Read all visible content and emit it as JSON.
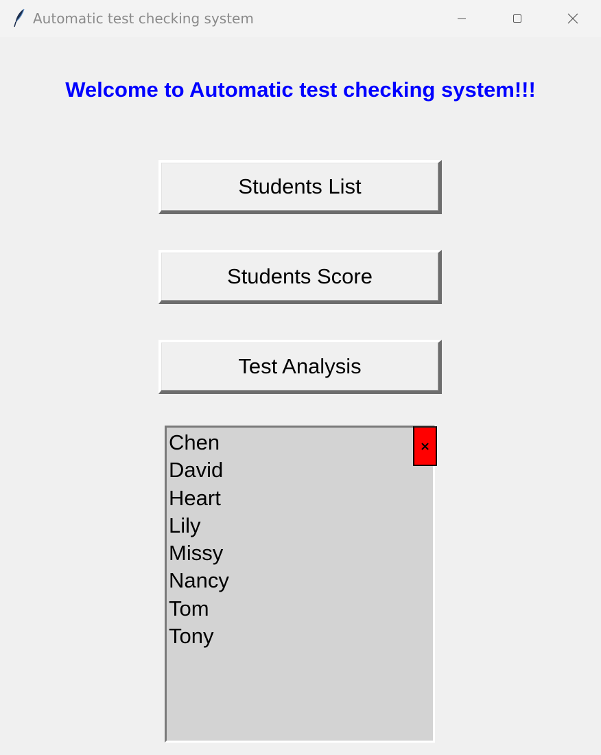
{
  "window": {
    "title": "Automatic test checking system",
    "icon": "feather-icon"
  },
  "header": {
    "welcome_text": "Welcome to Automatic test checking system!!!",
    "welcome_color": "#0000ff"
  },
  "buttons": {
    "students_list": "Students List",
    "students_score": "Students Score",
    "test_analysis": "Test Analysis"
  },
  "student_list": {
    "items": [
      "Chen",
      "David",
      "Heart",
      "Lily",
      "Missy",
      "Nancy",
      "Tom",
      "Tony"
    ],
    "background": "#d3d3d3",
    "close_label": "×",
    "close_color": "#ff0000"
  }
}
